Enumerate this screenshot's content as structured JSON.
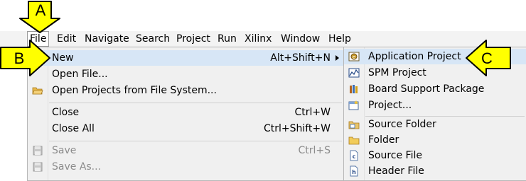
{
  "menubar": {
    "items": [
      "File",
      "Edit",
      "Navigate",
      "Search",
      "Project",
      "Run",
      "Xilinx",
      "Window",
      "Help"
    ]
  },
  "file_menu": {
    "items": [
      {
        "label": "New",
        "shortcut": "Alt+Shift+N"
      },
      {
        "label": "Open File...",
        "shortcut": ""
      },
      {
        "label": "Open Projects from File System...",
        "shortcut": ""
      },
      {
        "label": "Close",
        "shortcut": "Ctrl+W"
      },
      {
        "label": "Close All",
        "shortcut": "Ctrl+Shift+W"
      },
      {
        "label": "Save",
        "shortcut": "Ctrl+S"
      },
      {
        "label": "Save As...",
        "shortcut": ""
      }
    ]
  },
  "new_submenu": {
    "items": [
      {
        "label": "Application Project",
        "icon": "application-project-icon"
      },
      {
        "label": "SPM Project",
        "icon": "spm-project-icon"
      },
      {
        "label": "Board Support Package",
        "icon": "board-support-package-icon"
      },
      {
        "label": "Project...",
        "icon": "project-icon"
      },
      {
        "label": "Source Folder",
        "icon": "source-folder-icon"
      },
      {
        "label": "Folder",
        "icon": "folder-icon"
      },
      {
        "label": "Source File",
        "icon": "source-file-icon"
      },
      {
        "label": "Header File",
        "icon": "header-file-icon"
      }
    ]
  },
  "callouts": {
    "a": "A",
    "b": "B",
    "c": "C"
  },
  "colors": {
    "callout_fill": "#ffff00",
    "highlight": "#d7e6f6",
    "menu_bg": "#f0f0f0"
  }
}
